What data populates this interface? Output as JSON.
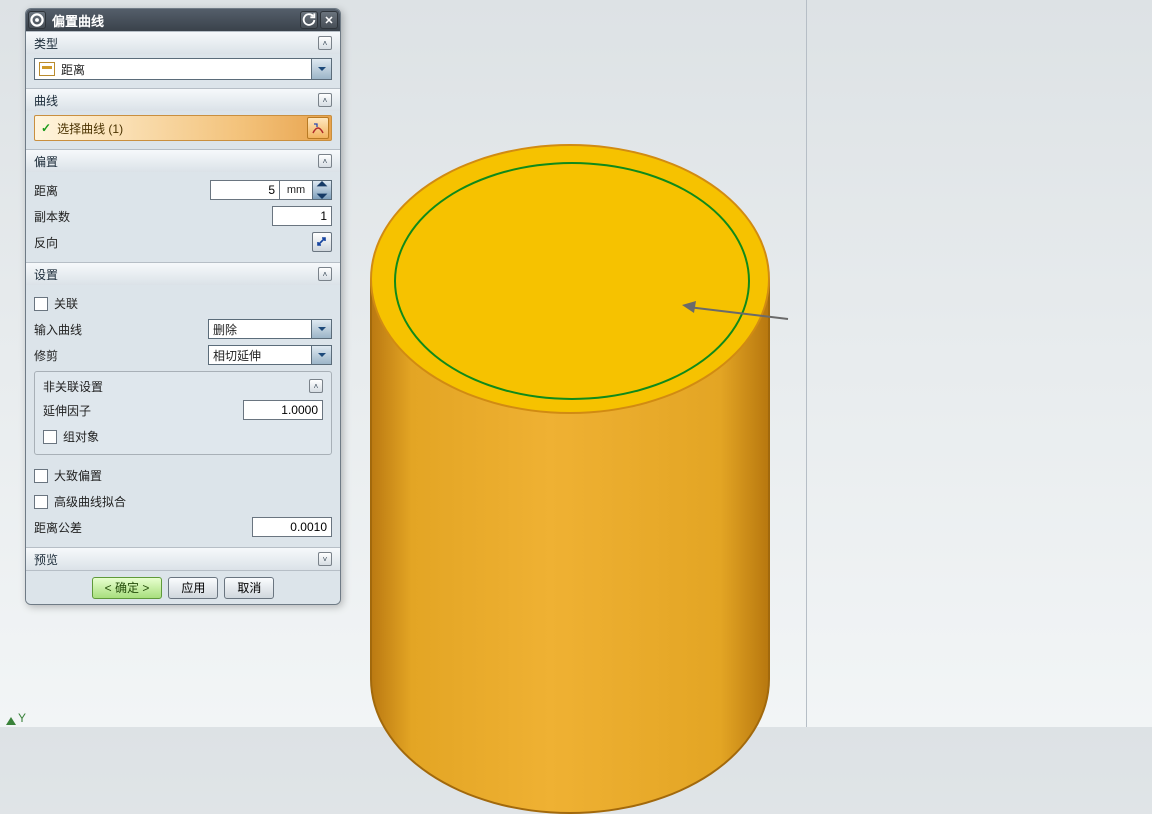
{
  "title": "偏置曲线",
  "sections": {
    "type": {
      "header": "类型",
      "select": "距离"
    },
    "curve": {
      "header": "曲线",
      "pick": "选择曲线 (1)"
    },
    "offset": {
      "header": "偏置",
      "distance_label": "距离",
      "distance_value": "5",
      "distance_unit": "mm",
      "copies_label": "副本数",
      "copies_value": "1",
      "reverse_label": "反向"
    },
    "settings": {
      "header": "设置",
      "assoc_label": "关联",
      "input_curve_label": "输入曲线",
      "input_curve_value": "删除",
      "trim_label": "修剪",
      "trim_value": "相切延伸",
      "nonassoc_header": "非关联设置",
      "ext_factor_label": "延伸因子",
      "ext_factor_value": "1.0000",
      "group_label": "组对象",
      "rough_label": "大致偏置",
      "adv_fit_label": "高级曲线拟合",
      "tol_label": "距离公差",
      "tol_value": "0.0010"
    },
    "preview": {
      "header": "预览"
    }
  },
  "buttons": {
    "ok": "< 确定 >",
    "apply": "应用",
    "cancel": "取消"
  },
  "axis": {
    "y": "Y"
  }
}
